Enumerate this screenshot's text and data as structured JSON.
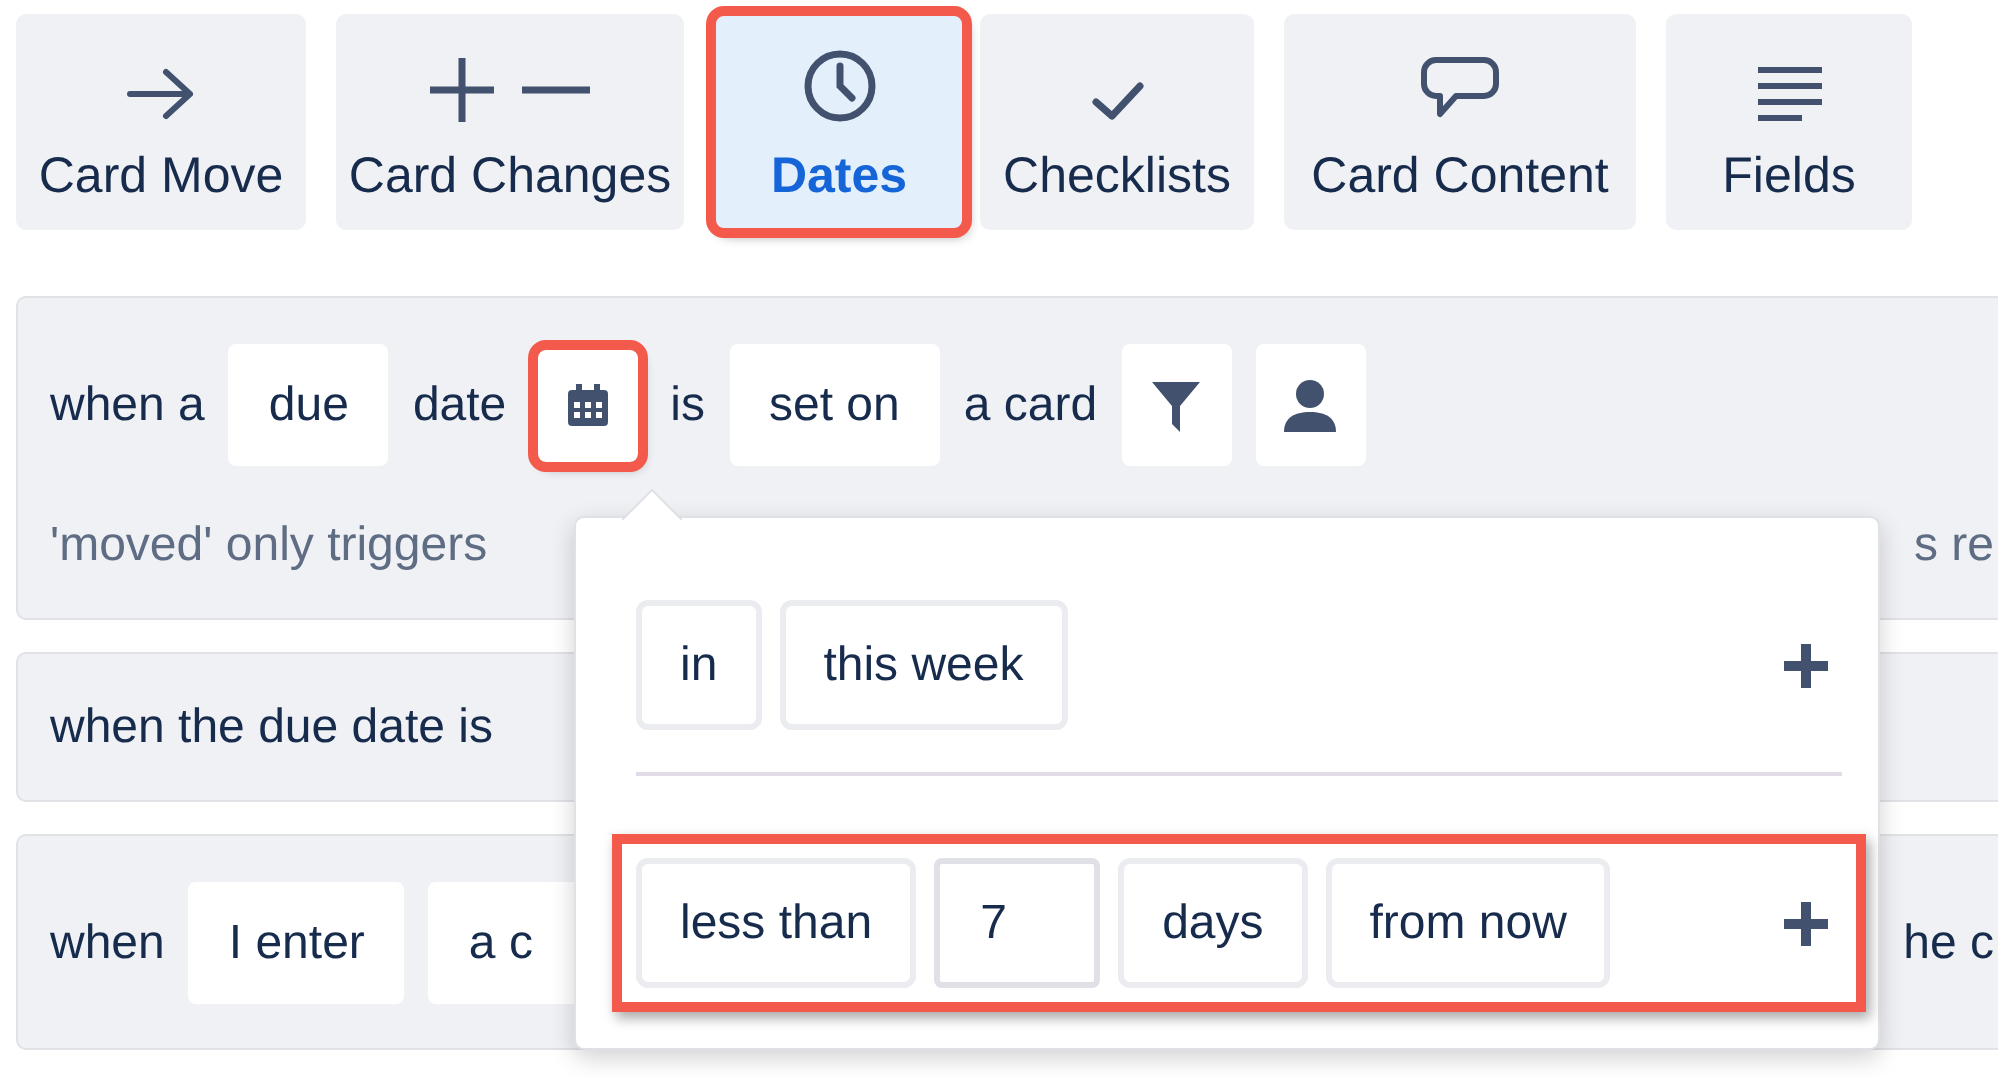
{
  "tabs": [
    {
      "kind": "move",
      "label": "Card Move",
      "selected": false,
      "highlighted": false
    },
    {
      "kind": "changes",
      "label": "Card Changes",
      "selected": false,
      "highlighted": false
    },
    {
      "kind": "dates",
      "label": "Dates",
      "selected": true,
      "highlighted": true
    },
    {
      "kind": "checklists",
      "label": "Checklists",
      "selected": false,
      "highlighted": false
    },
    {
      "kind": "content",
      "label": "Card Content",
      "selected": false,
      "highlighted": false
    },
    {
      "kind": "fields",
      "label": "Fields",
      "selected": false,
      "highlighted": false
    }
  ],
  "rules": [
    {
      "tokens": [
        {
          "kind": "text",
          "text": "when a"
        },
        {
          "kind": "chip",
          "text": "due"
        },
        {
          "kind": "text",
          "text": "date"
        },
        {
          "kind": "date-button",
          "highlighted": true
        },
        {
          "kind": "text",
          "text": "is"
        },
        {
          "kind": "chip",
          "text": "set on"
        },
        {
          "kind": "text",
          "text": "a card"
        },
        {
          "kind": "filter-button",
          "highlighted": false
        },
        {
          "kind": "member-button",
          "highlighted": false
        }
      ],
      "note": "'moved' only triggers",
      "note_end": "s re"
    },
    {
      "tokens": [
        {
          "kind": "text",
          "text": "when the due date is"
        }
      ]
    },
    {
      "tokens": [
        {
          "kind": "text",
          "text": "when"
        },
        {
          "kind": "chip",
          "text": "I enter"
        },
        {
          "kind": "chip",
          "text": "a c"
        }
      ],
      "end": "he c"
    }
  ],
  "popup": {
    "rows": [
      {
        "highlighted": false,
        "items": [
          {
            "kind": "chip",
            "text": "in"
          },
          {
            "kind": "chip",
            "text": "this week"
          }
        ]
      },
      {
        "highlighted": true,
        "items": [
          {
            "kind": "chip",
            "text": "less than"
          },
          {
            "kind": "input",
            "value": "7"
          },
          {
            "kind": "chip",
            "text": "days"
          },
          {
            "kind": "chip",
            "text": "from now"
          }
        ]
      }
    ]
  }
}
